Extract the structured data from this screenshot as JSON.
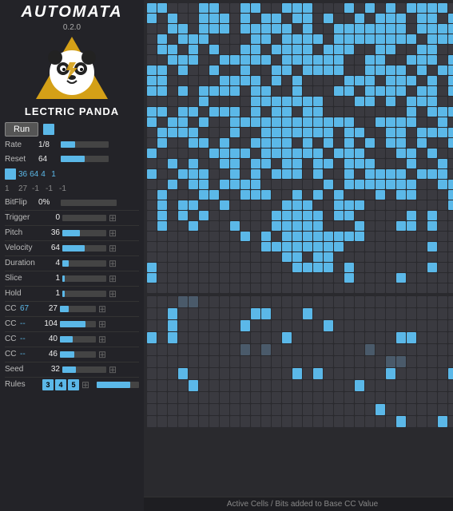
{
  "app": {
    "title": "AUTOMATA",
    "version": "0.2.0",
    "brand": "LECTRIC PANDA"
  },
  "controls": {
    "run_label": "Run",
    "rate_label": "Rate",
    "rate_value": "1/8",
    "reset_label": "Reset",
    "reset_value": "64",
    "grid_nums_row1": [
      "36",
      "64",
      "4",
      "1"
    ],
    "grid_nums_row2": [
      "1",
      "27",
      "-1",
      "-1",
      "-1"
    ],
    "bitflip_label": "BitFlip",
    "bitflip_value": "0%"
  },
  "sequencer": {
    "trigger": {
      "label": "Trigger",
      "value": "0",
      "bar_pct": 0
    },
    "pitch": {
      "label": "Pitch",
      "value": "36",
      "bar_pct": 40
    },
    "velocity": {
      "label": "Velocity",
      "value": "64",
      "bar_pct": 50
    },
    "duration": {
      "label": "Duration",
      "value": "4",
      "bar_pct": 15
    },
    "slice": {
      "label": "Slice",
      "value": "1",
      "bar_pct": 5
    },
    "hold": {
      "label": "Hold",
      "value": "1",
      "bar_pct": 5
    }
  },
  "cc_rows": [
    {
      "label": "CC",
      "num": "67",
      "value": "27",
      "bar_pct": 25
    },
    {
      "label": "CC",
      "num": "--",
      "value": "104",
      "bar_pct": 70
    },
    {
      "label": "CC",
      "num": "--",
      "value": "40",
      "bar_pct": 35
    },
    {
      "label": "CC",
      "num": "--",
      "value": "46",
      "bar_pct": 40
    }
  ],
  "seed": {
    "label": "Seed",
    "value": "32",
    "bar_pct": 30
  },
  "rules": {
    "label": "Rules",
    "values": [
      "3",
      "4",
      "5"
    ]
  },
  "status_bar": "Active Cells / Bits added to Base CC Value"
}
